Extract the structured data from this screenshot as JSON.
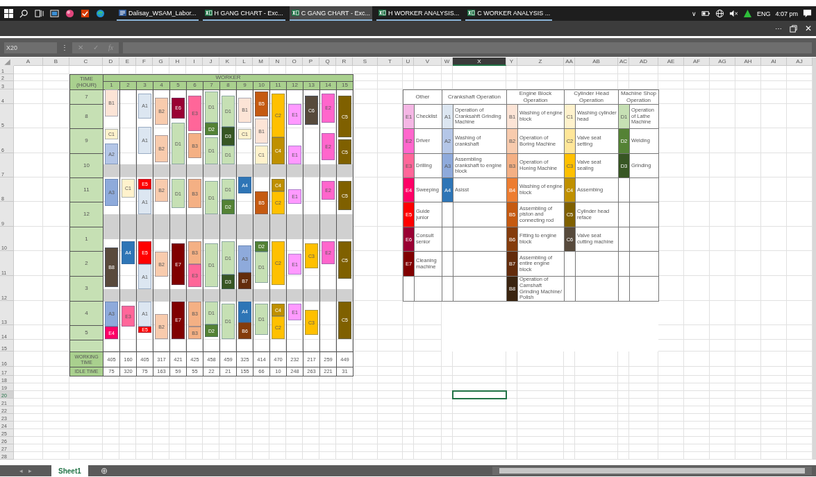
{
  "taskbar": {
    "windows": [
      {
        "label": "Dalisay_WSAM_Labor...",
        "kind": "word",
        "selected": false
      },
      {
        "label": "H GANG CHART - Exc...",
        "kind": "excel",
        "selected": false
      },
      {
        "label": "C GANG CHART - Exc...",
        "kind": "excel",
        "selected": true
      },
      {
        "label": "H WORKER ANALYSIS...",
        "kind": "excel",
        "selected": false
      },
      {
        "label": "C WORKER ANALYSIS ...",
        "kind": "excel",
        "selected": false
      }
    ],
    "tray": {
      "chevron": "∨",
      "language": "ENG",
      "time": "4:07 pm"
    }
  },
  "title_bar": {
    "more": "⋯",
    "close": "✕"
  },
  "formula_bar": {
    "name_box": "X20",
    "menu": "⋮",
    "cancel": "✕",
    "enter": "✓",
    "function": "fx"
  },
  "sheet": {
    "columns": [
      {
        "label": "A",
        "selected": false
      },
      {
        "label": "B",
        "selected": false
      },
      {
        "label": "C",
        "selected": false
      },
      {
        "label": "D",
        "selected": false
      },
      {
        "label": "E",
        "selected": false
      },
      {
        "label": "F",
        "selected": false
      },
      {
        "label": "G",
        "selected": false
      },
      {
        "label": "H",
        "selected": false
      },
      {
        "label": "I",
        "selected": false
      },
      {
        "label": "J",
        "selected": false
      },
      {
        "label": "K",
        "selected": false
      },
      {
        "label": "L",
        "selected": false
      },
      {
        "label": "M",
        "selected": false
      },
      {
        "label": "N",
        "selected": false
      },
      {
        "label": "O",
        "selected": false
      },
      {
        "label": "P",
        "selected": false
      },
      {
        "label": "Q",
        "selected": false
      },
      {
        "label": "R",
        "selected": false
      },
      {
        "label": "S",
        "selected": false
      },
      {
        "label": "T",
        "selected": false
      },
      {
        "label": "U",
        "selected": false
      },
      {
        "label": "V",
        "selected": false
      },
      {
        "label": "W",
        "selected": false
      },
      {
        "label": "X",
        "selected": true
      },
      {
        "label": "Y",
        "selected": false
      },
      {
        "label": "Z",
        "selected": false
      },
      {
        "label": "AA",
        "selected": false
      },
      {
        "label": "AB",
        "selected": false
      },
      {
        "label": "AC",
        "selected": false
      },
      {
        "label": "AD",
        "selected": false
      },
      {
        "label": "AE",
        "selected": false
      },
      {
        "label": "AF",
        "selected": false
      },
      {
        "label": "AG",
        "selected": false
      },
      {
        "label": "AH",
        "selected": false
      },
      {
        "label": "AI",
        "selected": false
      },
      {
        "label": "AJ",
        "selected": false
      }
    ],
    "rows": [
      {
        "label": "1",
        "selected": false
      },
      {
        "label": "2",
        "selected": false
      },
      {
        "label": "3",
        "selected": false
      },
      {
        "label": "4",
        "selected": false
      },
      {
        "label": "5",
        "selected": false
      },
      {
        "label": "6",
        "selected": false
      },
      {
        "label": "7",
        "selected": false
      },
      {
        "label": "8",
        "selected": false
      },
      {
        "label": "9",
        "selected": false
      },
      {
        "label": "10",
        "selected": false
      },
      {
        "label": "11",
        "selected": false
      },
      {
        "label": "12",
        "selected": false
      },
      {
        "label": "13",
        "selected": false
      },
      {
        "label": "14",
        "selected": false
      },
      {
        "label": "15",
        "selected": false
      },
      {
        "label": "16",
        "selected": false
      },
      {
        "label": "17",
        "selected": false
      },
      {
        "label": "18",
        "selected": false
      },
      {
        "label": "19",
        "selected": false
      },
      {
        "label": "20",
        "selected": true
      },
      {
        "label": "21",
        "selected": false
      },
      {
        "label": "22",
        "selected": false
      },
      {
        "label": "23",
        "selected": false
      },
      {
        "label": "24",
        "selected": false
      },
      {
        "label": "25",
        "selected": false
      },
      {
        "label": "26",
        "selected": false
      },
      {
        "label": "27",
        "selected": false
      },
      {
        "label": "28",
        "selected": false
      }
    ]
  },
  "gang_chart": {
    "time_header": "TIME (HOUR)",
    "worker_header": "WORKER",
    "hours": [
      "7",
      "8",
      "9",
      "10",
      "11",
      "12",
      "1",
      "2",
      "3",
      "4",
      "5"
    ],
    "working_label": "WORKING TIME",
    "idle_label": "IDLE TIME",
    "workers": [
      {
        "number": "1",
        "working_time": "405",
        "idle_time": "75",
        "blocks": [
          {
            "code": "B1",
            "color": "#fce4d6"
          },
          {
            "code": "C1",
            "color": "#fff2cc"
          },
          {
            "code": "A2",
            "color": "#b4c6e7"
          },
          {
            "code": "A3",
            "color": "#8eaadb"
          },
          {
            "code": "B8",
            "color": "#594a3c"
          },
          {
            "code": "A3",
            "color": "#8eaadb"
          },
          {
            "code": "E4",
            "color": "#ff0066"
          }
        ]
      },
      {
        "number": "2",
        "working_time": "160",
        "idle_time": "320",
        "blocks": [
          {
            "code": "C1",
            "color": "#fff2cc"
          },
          {
            "code": "A4",
            "color": "#2e75b6"
          },
          {
            "code": "E3",
            "color": "#ff6699"
          }
        ]
      },
      {
        "number": "3",
        "working_time": "405",
        "idle_time": "75",
        "blocks": [
          {
            "code": "A1",
            "color": "#dce6f1"
          },
          {
            "code": "A1",
            "color": "#dce6f1"
          },
          {
            "code": "E5",
            "color": "#ff0000"
          },
          {
            "code": "A1",
            "color": "#dce6f1"
          },
          {
            "code": "E5",
            "color": "#ff0000"
          },
          {
            "code": "A1",
            "color": "#dce6f1"
          },
          {
            "code": "A1",
            "color": "#dce6f1"
          },
          {
            "code": "E5",
            "color": "#ff0000"
          }
        ]
      },
      {
        "number": "4",
        "working_time": "317",
        "idle_time": "163",
        "blocks": [
          {
            "code": "B2",
            "color": "#f8cbad"
          },
          {
            "code": "B2",
            "color": "#f8cbad"
          },
          {
            "code": "B2",
            "color": "#f8cbad"
          },
          {
            "code": "B2",
            "color": "#f8cbad"
          },
          {
            "code": "B2",
            "color": "#f8cbad"
          }
        ]
      },
      {
        "number": "5",
        "working_time": "421",
        "idle_time": "59",
        "blocks": [
          {
            "code": "E6",
            "color": "#990033"
          },
          {
            "code": "D1",
            "color": "#c6e0b4"
          },
          {
            "code": "D1",
            "color": "#c6e0b4"
          },
          {
            "code": "E7",
            "color": "#800000"
          },
          {
            "code": "E7",
            "color": "#800000"
          }
        ]
      },
      {
        "number": "6",
        "working_time": "425",
        "idle_time": "55",
        "blocks": [
          {
            "code": "E3",
            "color": "#ff6699"
          },
          {
            "code": "B3",
            "color": "#f4b084"
          },
          {
            "code": "B3",
            "color": "#f4b084"
          },
          {
            "code": "B3",
            "color": "#f4b084"
          },
          {
            "code": "E3",
            "color": "#ff6699"
          },
          {
            "code": "B3",
            "color": "#f4b084"
          },
          {
            "code": "B3",
            "color": "#f4b084"
          }
        ]
      },
      {
        "number": "7",
        "working_time": "458",
        "idle_time": "22",
        "blocks": [
          {
            "code": "D1",
            "color": "#c6e0b4"
          },
          {
            "code": "D2",
            "color": "#548235"
          },
          {
            "code": "D1",
            "color": "#c6e0b4"
          },
          {
            "code": "D1",
            "color": "#c6e0b4"
          },
          {
            "code": "D1",
            "color": "#c6e0b4"
          },
          {
            "code": "D1",
            "color": "#c6e0b4"
          },
          {
            "code": "D2",
            "color": "#548235"
          }
        ]
      },
      {
        "number": "8",
        "working_time": "459",
        "idle_time": "21",
        "blocks": [
          {
            "code": "D1",
            "color": "#c6e0b4"
          },
          {
            "code": "D3",
            "color": "#375623"
          },
          {
            "code": "D1",
            "color": "#c6e0b4"
          },
          {
            "code": "D1",
            "color": "#c6e0b4"
          },
          {
            "code": "D2",
            "color": "#548235"
          },
          {
            "code": "D1",
            "color": "#c6e0b4"
          },
          {
            "code": "D3",
            "color": "#375623"
          },
          {
            "code": "D1",
            "color": "#c6e0b4"
          }
        ]
      },
      {
        "number": "9",
        "working_time": "325",
        "idle_time": "155",
        "blocks": [
          {
            "code": "B1",
            "color": "#fce4d6"
          },
          {
            "code": "C1",
            "color": "#fff2cc"
          },
          {
            "code": "A4",
            "color": "#2e75b6"
          },
          {
            "code": "A3",
            "color": "#8eaadb"
          },
          {
            "code": "B7",
            "color": "#632c0c"
          },
          {
            "code": "A4",
            "color": "#2e75b6"
          },
          {
            "code": "B6",
            "color": "#843c0c"
          }
        ]
      },
      {
        "number": "10",
        "working_time": "414",
        "idle_time": "66",
        "blocks": [
          {
            "code": "B5",
            "color": "#c55a11"
          },
          {
            "code": "B1",
            "color": "#fce4d6"
          },
          {
            "code": "C1",
            "color": "#fff2cc"
          },
          {
            "code": "B5",
            "color": "#c55a11"
          },
          {
            "code": "D2",
            "color": "#548235"
          },
          {
            "code": "D1",
            "color": "#c6e0b4"
          },
          {
            "code": "D1",
            "color": "#c6e0b4"
          }
        ]
      },
      {
        "number": "11",
        "working_time": "470",
        "idle_time": "10",
        "blocks": [
          {
            "code": "C2",
            "color": "#ffc000"
          },
          {
            "code": "C4",
            "color": "#bf9000"
          },
          {
            "code": "C4",
            "color": "#bf9000"
          },
          {
            "code": "C2",
            "color": "#ffc000"
          },
          {
            "code": "C2",
            "color": "#ffc000"
          },
          {
            "code": "C4",
            "color": "#bf9000"
          },
          {
            "code": "C2",
            "color": "#ffc000"
          }
        ]
      },
      {
        "number": "12",
        "working_time": "232",
        "idle_time": "248",
        "blocks": [
          {
            "code": "E1",
            "color": "#ff99ff"
          },
          {
            "code": "E1",
            "color": "#ff99ff"
          },
          {
            "code": "E1",
            "color": "#ff99ff"
          },
          {
            "code": "E1",
            "color": "#ff99ff"
          },
          {
            "code": "E1",
            "color": "#ff99ff"
          }
        ]
      },
      {
        "number": "13",
        "working_time": "217",
        "idle_time": "263",
        "blocks": [
          {
            "code": "C6",
            "color": "#574a3c"
          },
          {
            "code": "C3",
            "color": "#ffc000"
          },
          {
            "code": "C3",
            "color": "#ffc000"
          }
        ]
      },
      {
        "number": "14",
        "working_time": "259",
        "idle_time": "221",
        "blocks": [
          {
            "code": "E2",
            "color": "#ff66cc"
          },
          {
            "code": "E2",
            "color": "#ff66cc"
          },
          {
            "code": "E2",
            "color": "#ff66cc"
          },
          {
            "code": "E2",
            "color": "#ff66cc"
          }
        ]
      },
      {
        "number": "15",
        "working_time": "449",
        "idle_time": "31",
        "blocks": [
          {
            "code": "C5",
            "color": "#7f6000"
          },
          {
            "code": "C5",
            "color": "#7f6000"
          },
          {
            "code": "C5",
            "color": "#7f6000"
          },
          {
            "code": "C5",
            "color": "#7f6000"
          },
          {
            "code": "C5",
            "color": "#7f6000"
          }
        ]
      }
    ]
  },
  "legend": {
    "groups": [
      {
        "title": "Other",
        "items": [
          {
            "code": "E1",
            "label": "Checklist",
            "color": "#f4b6e4"
          },
          {
            "code": "E2",
            "label": "Driver",
            "color": "#ff66cc"
          },
          {
            "code": "E3",
            "label": "Drilling",
            "color": "#ff6699"
          },
          {
            "code": "E4",
            "label": "Sweeping",
            "color": "#ff0066"
          },
          {
            "code": "E5",
            "label": "Guide junior",
            "color": "#ff0000"
          },
          {
            "code": "E6",
            "label": "Consult senior",
            "color": "#990033"
          },
          {
            "code": "E7",
            "label": "Cleaning machine",
            "color": "#800000"
          }
        ]
      },
      {
        "title": "Crankshaft Operation",
        "items": [
          {
            "code": "A1",
            "label": "Operation of Cranksahft Grinding Machine",
            "color": "#dce6f1"
          },
          {
            "code": "A2",
            "label": "Washing of crankshaft",
            "color": "#b4c6e7"
          },
          {
            "code": "A3",
            "label": "Assembling crankshaft to engine block",
            "color": "#8eaadb"
          },
          {
            "code": "A4",
            "label": "Asisst",
            "color": "#2e75b6"
          }
        ]
      },
      {
        "title": "Engine Block Operation",
        "items": [
          {
            "code": "B1",
            "label": "Washing of engine block",
            "color": "#fce4d6"
          },
          {
            "code": "B2",
            "label": "Operation of Boring Machine",
            "color": "#f8cbad"
          },
          {
            "code": "B3",
            "label": "Operation of Honing Machine",
            "color": "#f4b084"
          },
          {
            "code": "B4",
            "label": "Washing of engine block",
            "color": "#ed7d31"
          },
          {
            "code": "B5",
            "label": "Assembling of piston and connecting rod",
            "color": "#c55a11"
          },
          {
            "code": "B6",
            "label": "Fitting to engine block",
            "color": "#843c0c"
          },
          {
            "code": "B7",
            "label": "Assembling of entire engine block",
            "color": "#632c0c"
          },
          {
            "code": "B8",
            "label": "Operation of Camshaft Grinding Machine/ Polish",
            "color": "#3a2410"
          }
        ]
      },
      {
        "title": "Cylinder Head Operation",
        "items": [
          {
            "code": "C1",
            "label": "Washing cylinder head",
            "color": "#fff2cc"
          },
          {
            "code": "C2",
            "label": "Valve seat setting",
            "color": "#ffe699"
          },
          {
            "code": "C3",
            "label": "Valve seat sealing",
            "color": "#ffc000"
          },
          {
            "code": "C4",
            "label": "Assembing",
            "color": "#bf9000"
          },
          {
            "code": "C5",
            "label": "Cylinder head reface",
            "color": "#7f6000"
          },
          {
            "code": "C6",
            "label": "Valve seat cutting machine",
            "color": "#574a3c"
          }
        ]
      },
      {
        "title": "Machine Shop Operation",
        "items": [
          {
            "code": "D1",
            "label": "Operation of Lathe Machine",
            "color": "#c6e0b4"
          },
          {
            "code": "D2",
            "label": "Welding",
            "color": "#548235"
          },
          {
            "code": "D3",
            "label": "Grinding",
            "color": "#375623"
          }
        ]
      }
    ]
  },
  "sheet_tabs": {
    "tabs": [
      {
        "label": "Sheet1",
        "selected": true
      }
    ],
    "add": "⊕",
    "prev": "◂",
    "next": "▸"
  }
}
